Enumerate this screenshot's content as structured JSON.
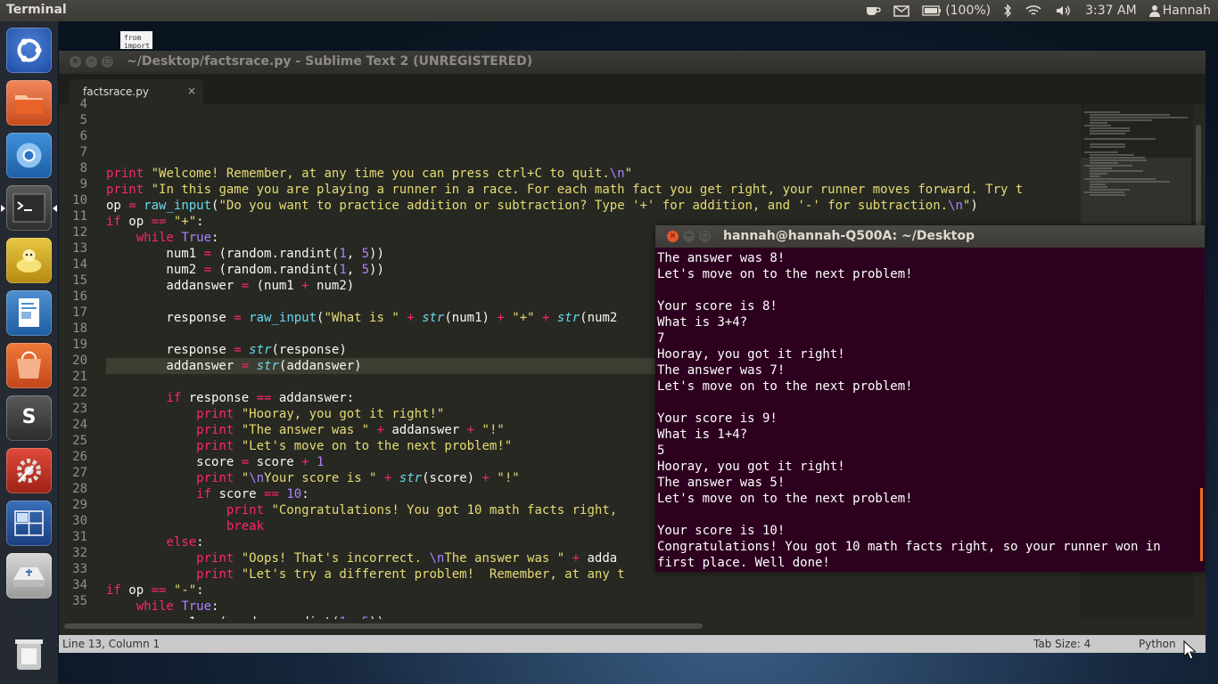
{
  "panel": {
    "app_title": "Terminal",
    "battery": "(100%)",
    "clock": "3:37 AM",
    "user": "Hannah"
  },
  "desktop_file": {
    "label": "from\nimport"
  },
  "sublime": {
    "title": "~/Desktop/factsrace.py - Sublime Text 2 (UNREGISTERED)",
    "tab_label": "factsrace.py",
    "line_numbers": [
      "4",
      "5",
      "6",
      "7",
      "8",
      "9",
      "10",
      "11",
      "12",
      "13",
      "14",
      "15",
      "16",
      "17",
      "18",
      "19",
      "20",
      "21",
      "22",
      "23",
      "24",
      "25",
      "26",
      "27",
      "28",
      "29",
      "30",
      "31",
      "32",
      "33",
      "34",
      "35"
    ],
    "status_position": "Line 13, Column 1",
    "status_tab_size": "Tab Size: 4",
    "status_language": "Python"
  },
  "terminal": {
    "title": "hannah@hannah-Q500A: ~/Desktop",
    "lines": [
      "The answer was 8!",
      "Let's move on to the next problem!",
      "",
      "Your score is 8!",
      "What is 3+4?",
      "7",
      "Hooray, you got it right!",
      "The answer was 7!",
      "Let's move on to the next problem!",
      "",
      "Your score is 9!",
      "What is 1+4?",
      "5",
      "Hooray, you got it right!",
      "The answer was 5!",
      "Let's move on to the next problem!",
      "",
      "Your score is 10!",
      "Congratulations! You got 10 math facts right, so your runner won in",
      "first place. Well done!"
    ]
  },
  "icons": {
    "launcher": [
      "ubuntu-dash-icon",
      "files-icon",
      "chromium-icon",
      "terminal-icon",
      "genie-icon",
      "libreoffice-writer-icon",
      "software-center-icon",
      "sublime-text-icon",
      "system-settings-icon",
      "workspace-switcher-icon",
      "usb-drive-icon",
      "trash-icon"
    ]
  },
  "colors": {
    "editor_bg": "#272822",
    "terminal_bg": "#2c001e",
    "keyword": "#f92672",
    "string": "#e6db74",
    "builtin": "#66d9ef",
    "number": "#ae81ff"
  }
}
